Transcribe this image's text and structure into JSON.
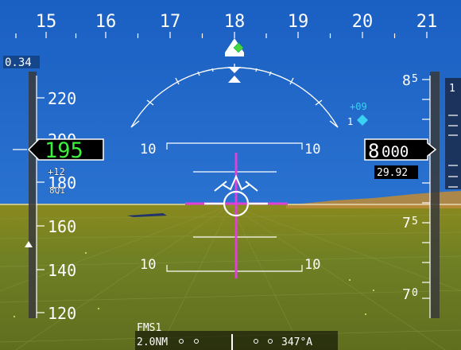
{
  "window": {
    "title": ""
  },
  "heading": {
    "ticks": [
      "15",
      "16",
      "17",
      "18",
      "19",
      "20",
      "21"
    ],
    "selected_marker": "heading-bug-icon"
  },
  "mach": "0.34",
  "airspeed": {
    "current": "195",
    "ticks": [
      "220",
      "200",
      "180",
      "160",
      "140",
      "120"
    ],
    "trend_value": "+12",
    "trend_sub": "8Q1",
    "bug": "speed-bug-icon"
  },
  "altitude": {
    "current_big": "8",
    "current_small": "000",
    "baro": "29.92",
    "ticks_big": [
      "8",
      "7",
      "7"
    ],
    "ticks_small": [
      "5",
      "5",
      "0"
    ],
    "selected_small": "1"
  },
  "vertical_speed": {
    "value": "+09",
    "marker_label": "1"
  },
  "pitch_ladder": {
    "upper_left": "10",
    "upper_right": "10",
    "lower_left": "10",
    "lower_right": "10"
  },
  "nav": {
    "source": "FMS1",
    "distance": "2.0NM",
    "bearing": "347°A"
  },
  "colors": {
    "sky": "#1d64c6",
    "ground": "#6b7d22",
    "symbology": "#ffffff",
    "speed_text": "#3ef03e",
    "magenta": "#e040d8",
    "cyan_marker": "#3ad0f0",
    "tape_bg": "#2a2a2a"
  }
}
